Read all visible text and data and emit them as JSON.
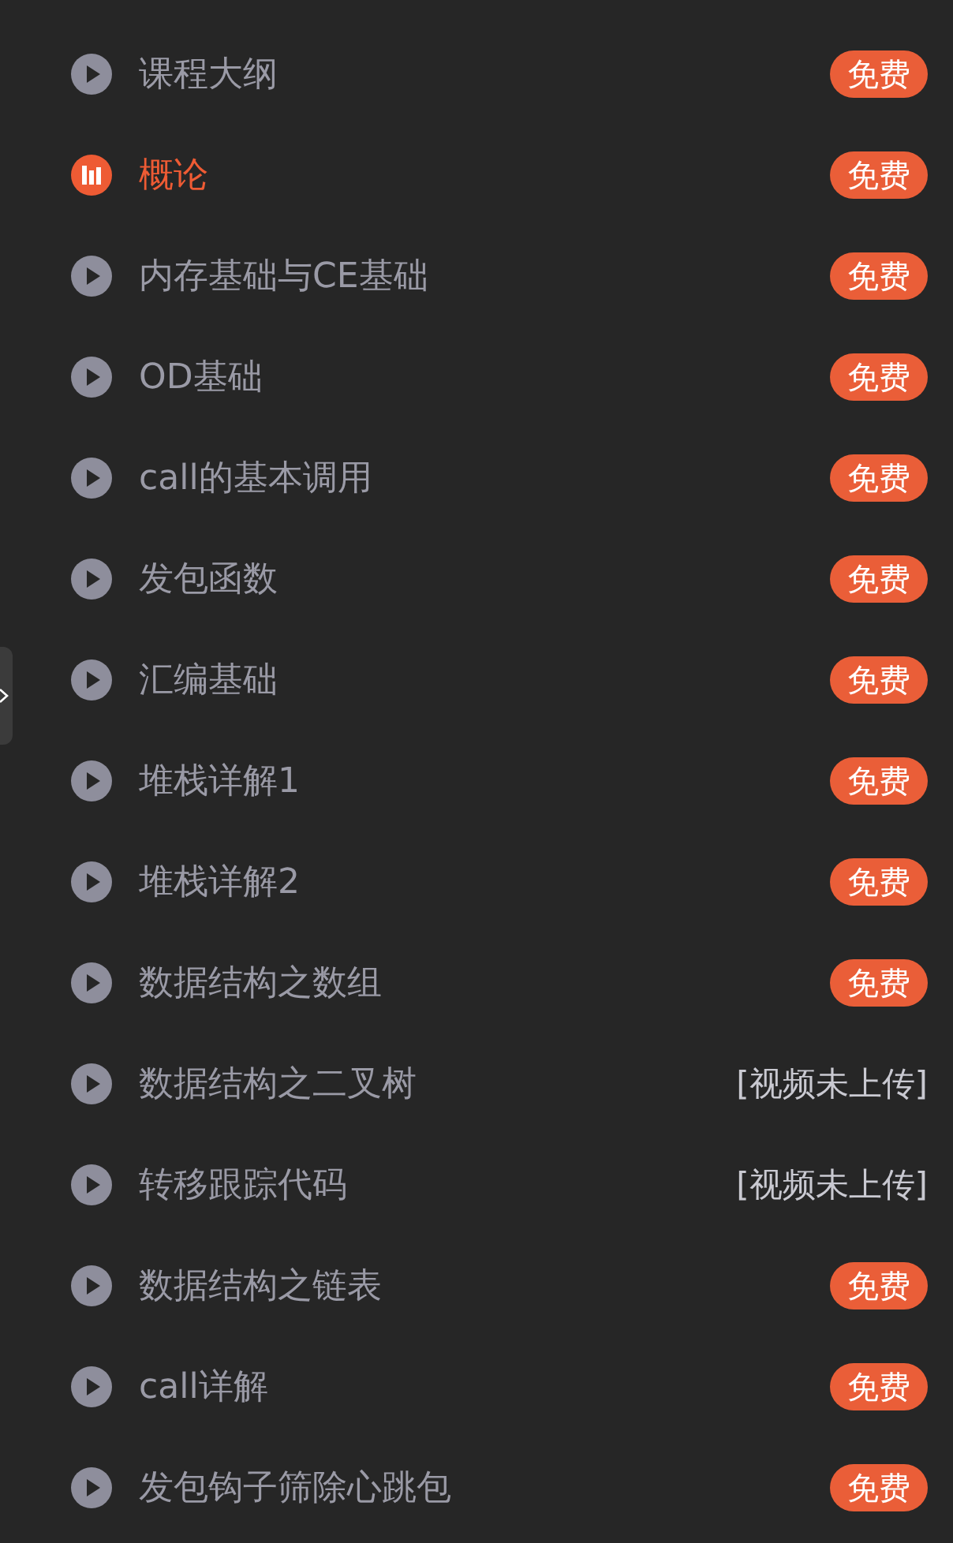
{
  "lessons": [
    {
      "title": "课程大纲",
      "selected": false,
      "status": {
        "kind": "badge",
        "text": "免费"
      }
    },
    {
      "title": "概论",
      "selected": true,
      "status": {
        "kind": "badge",
        "text": "免费"
      }
    },
    {
      "title": "内存基础与CE基础",
      "selected": false,
      "status": {
        "kind": "badge",
        "text": "免费"
      }
    },
    {
      "title": "OD基础",
      "selected": false,
      "status": {
        "kind": "badge",
        "text": "免费"
      }
    },
    {
      "title": "call的基本调用",
      "selected": false,
      "status": {
        "kind": "badge",
        "text": "免费"
      }
    },
    {
      "title": "发包函数",
      "selected": false,
      "status": {
        "kind": "badge",
        "text": "免费"
      }
    },
    {
      "title": "汇编基础",
      "selected": false,
      "status": {
        "kind": "badge",
        "text": "免费"
      }
    },
    {
      "title": "堆栈详解1",
      "selected": false,
      "status": {
        "kind": "badge",
        "text": "免费"
      }
    },
    {
      "title": "堆栈详解2",
      "selected": false,
      "status": {
        "kind": "badge",
        "text": "免费"
      }
    },
    {
      "title": "数据结构之数组",
      "selected": false,
      "status": {
        "kind": "badge",
        "text": "免费"
      }
    },
    {
      "title": "数据结构之二叉树",
      "selected": false,
      "status": {
        "kind": "note",
        "text": "[视频未上传]"
      }
    },
    {
      "title": "转移跟踪代码",
      "selected": false,
      "status": {
        "kind": "note",
        "text": "[视频未上传]"
      }
    },
    {
      "title": "数据结构之链表",
      "selected": false,
      "status": {
        "kind": "badge",
        "text": "免费"
      }
    },
    {
      "title": "call详解",
      "selected": false,
      "status": {
        "kind": "badge",
        "text": "免费"
      }
    },
    {
      "title": "发包钩子筛除心跳包",
      "selected": false,
      "status": {
        "kind": "badge",
        "text": "免费"
      }
    }
  ]
}
